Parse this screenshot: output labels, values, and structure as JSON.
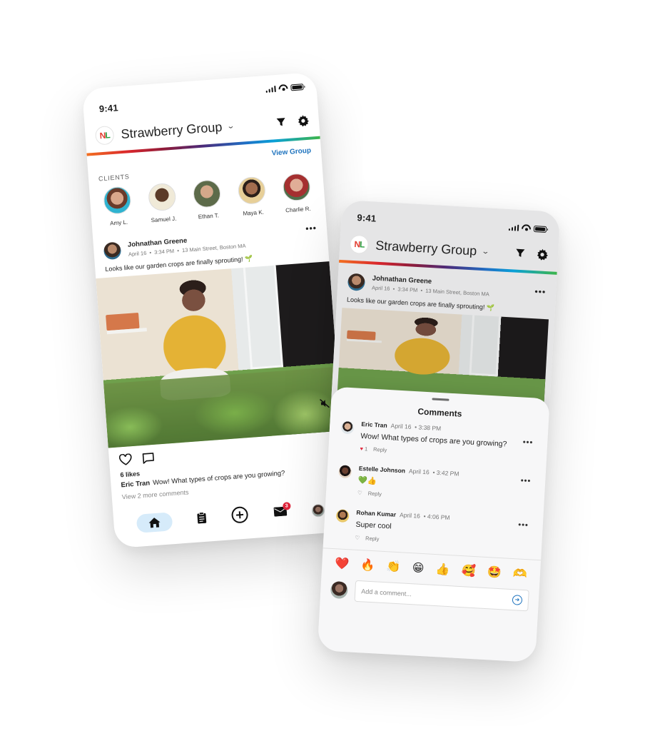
{
  "status_bar": {
    "time": "9:41"
  },
  "app_bar": {
    "group_name": "Strawberry Group",
    "logo_text_n": "N",
    "logo_text_l": "L"
  },
  "clients": {
    "label": "CLIENTS",
    "view_group_label": "View Group",
    "items": [
      {
        "name": "Amy L.",
        "color": "#c9a08a"
      },
      {
        "name": "Samuel J.",
        "color": "#6b4a34"
      },
      {
        "name": "Ethan T.",
        "color": "#7c8a6a"
      },
      {
        "name": "Maya K.",
        "color": "#8a5f46"
      },
      {
        "name": "Charlie R.",
        "color": "#b97f6c"
      }
    ]
  },
  "post": {
    "author": "Johnathan Greene",
    "date": "April 16",
    "time": "3:34 PM",
    "location": "13 Main Street, Boston MA",
    "text": "Looks like our garden crops are finally sprouting!",
    "emoji": "🌱",
    "likes": "6 likes",
    "preview_comment_author": "Eric Tran",
    "preview_comment_text": "Wow! What types of crops are you growing?",
    "view_more": "View 2 more comments"
  },
  "bottom_nav": {
    "items": [
      {
        "name": "home",
        "active": true
      },
      {
        "name": "tasks"
      },
      {
        "name": "add"
      },
      {
        "name": "messages",
        "badge": "3"
      },
      {
        "name": "profile"
      }
    ]
  },
  "comments_sheet": {
    "title": "Comments",
    "comments": [
      {
        "author": "Eric Tran",
        "date": "April 16",
        "time": "3:38 PM",
        "text": "Wow! What types of crops are you growing?",
        "likes": "1",
        "liked": true,
        "reply": "Reply",
        "avatar_color": "#b58a70"
      },
      {
        "author": "Estelle Johnson",
        "date": "April 16",
        "time": "3:42 PM",
        "text": "💚👍",
        "likes": "",
        "liked": false,
        "reply": "Reply",
        "avatar_color": "#5a3a2c"
      },
      {
        "author": "Rohan Kumar",
        "date": "April 16",
        "time": "4:06 PM",
        "text": "Super cool",
        "likes": "",
        "liked": false,
        "reply": "Reply",
        "avatar_color": "#8a6040"
      }
    ],
    "reactions": [
      "❤️",
      "🔥",
      "👏",
      "😁",
      "👍",
      "🥰",
      "🤩",
      "🫶"
    ],
    "input_placeholder": "Add a comment..."
  },
  "colors": {
    "accent": "#1e73be",
    "badge": "#e0263c",
    "home_pill": "#d6ebfa"
  }
}
